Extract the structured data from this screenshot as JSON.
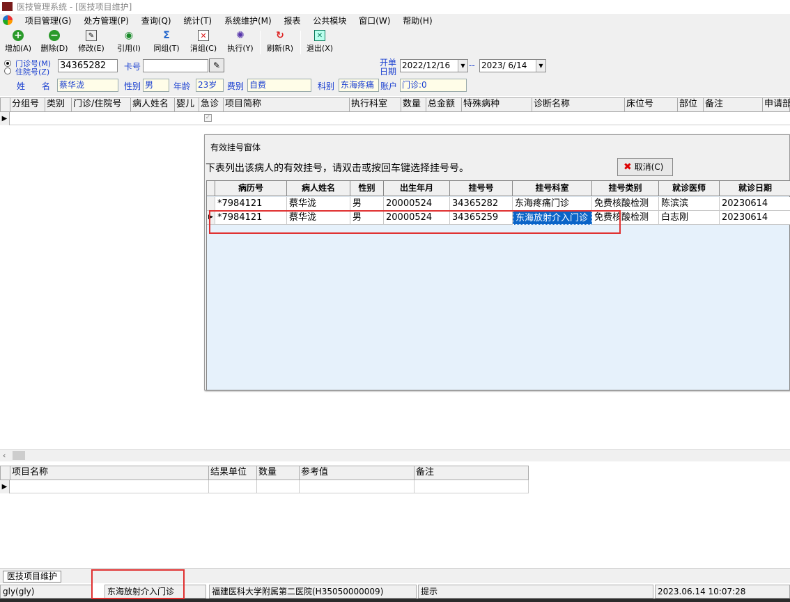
{
  "window": {
    "title": "医技管理系统 - [医技项目维护]"
  },
  "menu": [
    "项目管理(G)",
    "处方管理(P)",
    "查询(Q)",
    "统计(T)",
    "系统维护(M)",
    "报表",
    "公共模块",
    "窗口(W)",
    "帮助(H)"
  ],
  "toolbar": {
    "add": "增加(A)",
    "delete": "删除(D)",
    "edit": "修改(E)",
    "reference": "引用(I)",
    "same_group": "同组(T)",
    "cancel_group": "消组(C)",
    "execute": "执行(Y)",
    "refresh": "刷新(R)",
    "exit": "退出(X)"
  },
  "form": {
    "radio_outpatient": "门诊号(M)",
    "radio_inpatient": "住院号(Z)",
    "patient_no": "34365282",
    "card_label": "卡号",
    "card_value": "",
    "order_date_label_1": "开单",
    "order_date_label_2": "日期",
    "date_from": "2022/12/16",
    "date_sep": "--",
    "date_to": "2023/ 6/14",
    "name_label": "姓　　名",
    "name_value": "蔡华泷",
    "sex_label": "性别",
    "sex_value": "男",
    "age_label": "年龄",
    "age_value": "23岁",
    "fee_label": "费别",
    "fee_value": "自费",
    "dept_label": "科别",
    "dept_value": "东海疼痛",
    "account_label": "账户",
    "account_value": "门诊:0"
  },
  "main_grid": {
    "columns": [
      "分组号",
      "类别",
      "门诊/住院号",
      "病人姓名",
      "婴儿",
      "急诊",
      "项目简称",
      "执行科室",
      "数量",
      "总金额",
      "特殊病种",
      "诊断名称",
      "床位号",
      "部位",
      "备注",
      "申请部"
    ]
  },
  "dialog": {
    "title": "有效挂号窗体",
    "instruction": "下表列出该病人的有效挂号，请双击或按回车键选择挂号号。",
    "cancel_button": "取消(C)",
    "columns": [
      "病历号",
      "病人姓名",
      "性别",
      "出生年月",
      "挂号号",
      "挂号科室",
      "挂号类别",
      "就诊医师",
      "就诊日期"
    ],
    "rows": [
      [
        "*7984121",
        "蔡华泷",
        "男",
        "20000524",
        "34365282",
        "东海疼痛门诊",
        "免费核酸检测",
        "陈滨滨",
        "20230614"
      ],
      [
        "*7984121",
        "蔡华泷",
        "男",
        "20000524",
        "34365259",
        "东海放射介入门诊",
        "免费核酸检测",
        "白志刚",
        "20230614"
      ]
    ]
  },
  "bottom_grid": {
    "columns": [
      "项目名称",
      "结果单位",
      "数量",
      "参考值",
      "备注"
    ]
  },
  "taskbar": {
    "tab": "医技项目维护"
  },
  "statusbar": {
    "user": "gly(gly)",
    "dept": "东海放射介入门诊",
    "hospital": "福建医科大学附属第二医院(H35050000009)",
    "hint": "提示",
    "datetime": "2023.06.14 10:07:28"
  },
  "colors": {
    "selection": "#0a64c8",
    "highlight_box": "#e03030",
    "grid_bg": "#e6f1fb"
  }
}
